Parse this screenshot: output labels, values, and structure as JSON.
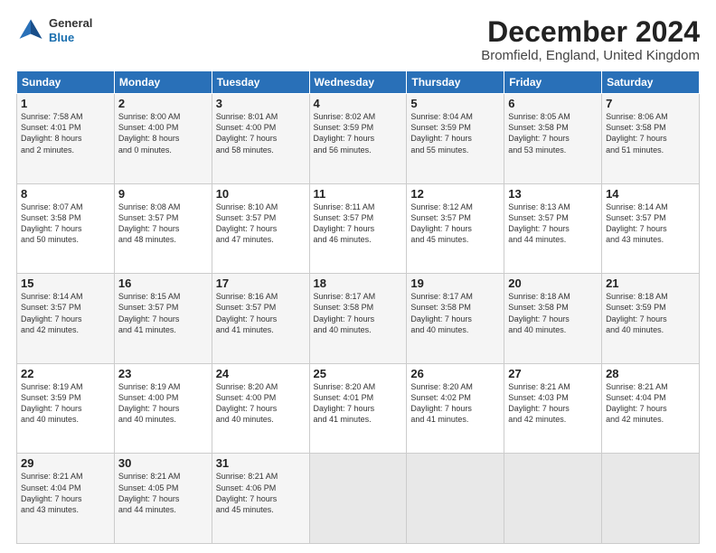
{
  "logo": {
    "line1": "General",
    "line2": "Blue"
  },
  "title": "December 2024",
  "subtitle": "Bromfield, England, United Kingdom",
  "days_of_week": [
    "Sunday",
    "Monday",
    "Tuesday",
    "Wednesday",
    "Thursday",
    "Friday",
    "Saturday"
  ],
  "weeks": [
    [
      {
        "day": "1",
        "info": "Sunrise: 7:58 AM\nSunset: 4:01 PM\nDaylight: 8 hours\nand 2 minutes."
      },
      {
        "day": "2",
        "info": "Sunrise: 8:00 AM\nSunset: 4:00 PM\nDaylight: 8 hours\nand 0 minutes."
      },
      {
        "day": "3",
        "info": "Sunrise: 8:01 AM\nSunset: 4:00 PM\nDaylight: 7 hours\nand 58 minutes."
      },
      {
        "day": "4",
        "info": "Sunrise: 8:02 AM\nSunset: 3:59 PM\nDaylight: 7 hours\nand 56 minutes."
      },
      {
        "day": "5",
        "info": "Sunrise: 8:04 AM\nSunset: 3:59 PM\nDaylight: 7 hours\nand 55 minutes."
      },
      {
        "day": "6",
        "info": "Sunrise: 8:05 AM\nSunset: 3:58 PM\nDaylight: 7 hours\nand 53 minutes."
      },
      {
        "day": "7",
        "info": "Sunrise: 8:06 AM\nSunset: 3:58 PM\nDaylight: 7 hours\nand 51 minutes."
      }
    ],
    [
      {
        "day": "8",
        "info": "Sunrise: 8:07 AM\nSunset: 3:58 PM\nDaylight: 7 hours\nand 50 minutes."
      },
      {
        "day": "9",
        "info": "Sunrise: 8:08 AM\nSunset: 3:57 PM\nDaylight: 7 hours\nand 48 minutes."
      },
      {
        "day": "10",
        "info": "Sunrise: 8:10 AM\nSunset: 3:57 PM\nDaylight: 7 hours\nand 47 minutes."
      },
      {
        "day": "11",
        "info": "Sunrise: 8:11 AM\nSunset: 3:57 PM\nDaylight: 7 hours\nand 46 minutes."
      },
      {
        "day": "12",
        "info": "Sunrise: 8:12 AM\nSunset: 3:57 PM\nDaylight: 7 hours\nand 45 minutes."
      },
      {
        "day": "13",
        "info": "Sunrise: 8:13 AM\nSunset: 3:57 PM\nDaylight: 7 hours\nand 44 minutes."
      },
      {
        "day": "14",
        "info": "Sunrise: 8:14 AM\nSunset: 3:57 PM\nDaylight: 7 hours\nand 43 minutes."
      }
    ],
    [
      {
        "day": "15",
        "info": "Sunrise: 8:14 AM\nSunset: 3:57 PM\nDaylight: 7 hours\nand 42 minutes."
      },
      {
        "day": "16",
        "info": "Sunrise: 8:15 AM\nSunset: 3:57 PM\nDaylight: 7 hours\nand 41 minutes."
      },
      {
        "day": "17",
        "info": "Sunrise: 8:16 AM\nSunset: 3:57 PM\nDaylight: 7 hours\nand 41 minutes."
      },
      {
        "day": "18",
        "info": "Sunrise: 8:17 AM\nSunset: 3:58 PM\nDaylight: 7 hours\nand 40 minutes."
      },
      {
        "day": "19",
        "info": "Sunrise: 8:17 AM\nSunset: 3:58 PM\nDaylight: 7 hours\nand 40 minutes."
      },
      {
        "day": "20",
        "info": "Sunrise: 8:18 AM\nSunset: 3:58 PM\nDaylight: 7 hours\nand 40 minutes."
      },
      {
        "day": "21",
        "info": "Sunrise: 8:18 AM\nSunset: 3:59 PM\nDaylight: 7 hours\nand 40 minutes."
      }
    ],
    [
      {
        "day": "22",
        "info": "Sunrise: 8:19 AM\nSunset: 3:59 PM\nDaylight: 7 hours\nand 40 minutes."
      },
      {
        "day": "23",
        "info": "Sunrise: 8:19 AM\nSunset: 4:00 PM\nDaylight: 7 hours\nand 40 minutes."
      },
      {
        "day": "24",
        "info": "Sunrise: 8:20 AM\nSunset: 4:00 PM\nDaylight: 7 hours\nand 40 minutes."
      },
      {
        "day": "25",
        "info": "Sunrise: 8:20 AM\nSunset: 4:01 PM\nDaylight: 7 hours\nand 41 minutes."
      },
      {
        "day": "26",
        "info": "Sunrise: 8:20 AM\nSunset: 4:02 PM\nDaylight: 7 hours\nand 41 minutes."
      },
      {
        "day": "27",
        "info": "Sunrise: 8:21 AM\nSunset: 4:03 PM\nDaylight: 7 hours\nand 42 minutes."
      },
      {
        "day": "28",
        "info": "Sunrise: 8:21 AM\nSunset: 4:04 PM\nDaylight: 7 hours\nand 42 minutes."
      }
    ],
    [
      {
        "day": "29",
        "info": "Sunrise: 8:21 AM\nSunset: 4:04 PM\nDaylight: 7 hours\nand 43 minutes."
      },
      {
        "day": "30",
        "info": "Sunrise: 8:21 AM\nSunset: 4:05 PM\nDaylight: 7 hours\nand 44 minutes."
      },
      {
        "day": "31",
        "info": "Sunrise: 8:21 AM\nSunset: 4:06 PM\nDaylight: 7 hours\nand 45 minutes."
      },
      {
        "day": "",
        "info": ""
      },
      {
        "day": "",
        "info": ""
      },
      {
        "day": "",
        "info": ""
      },
      {
        "day": "",
        "info": ""
      }
    ]
  ]
}
